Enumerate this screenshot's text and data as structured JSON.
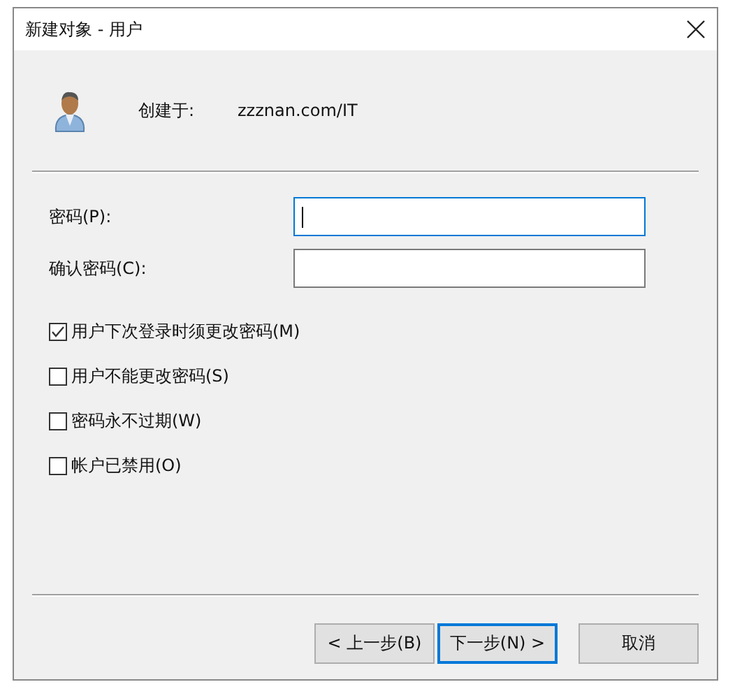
{
  "window": {
    "title": "新建对象 - 用户"
  },
  "created_in": {
    "label": "创建于:",
    "value": "zzznan.com/IT"
  },
  "fields": [
    {
      "label": "密码(P):",
      "focused": true
    },
    {
      "label": "确认密码(C):",
      "focused": false
    }
  ],
  "options": [
    {
      "label": "用户下次登录时须更改密码(M)",
      "checked": true
    },
    {
      "label": "用户不能更改密码(S)",
      "checked": false
    },
    {
      "label": "密码永不过期(W)",
      "checked": false
    },
    {
      "label": "帐户已禁用(O)",
      "checked": false
    }
  ],
  "buttons": [
    {
      "label": "< 上一步(B)",
      "focused": false
    },
    {
      "label": "下一步(N) >",
      "focused": true
    },
    {
      "label": "取消",
      "focused": false
    }
  ]
}
